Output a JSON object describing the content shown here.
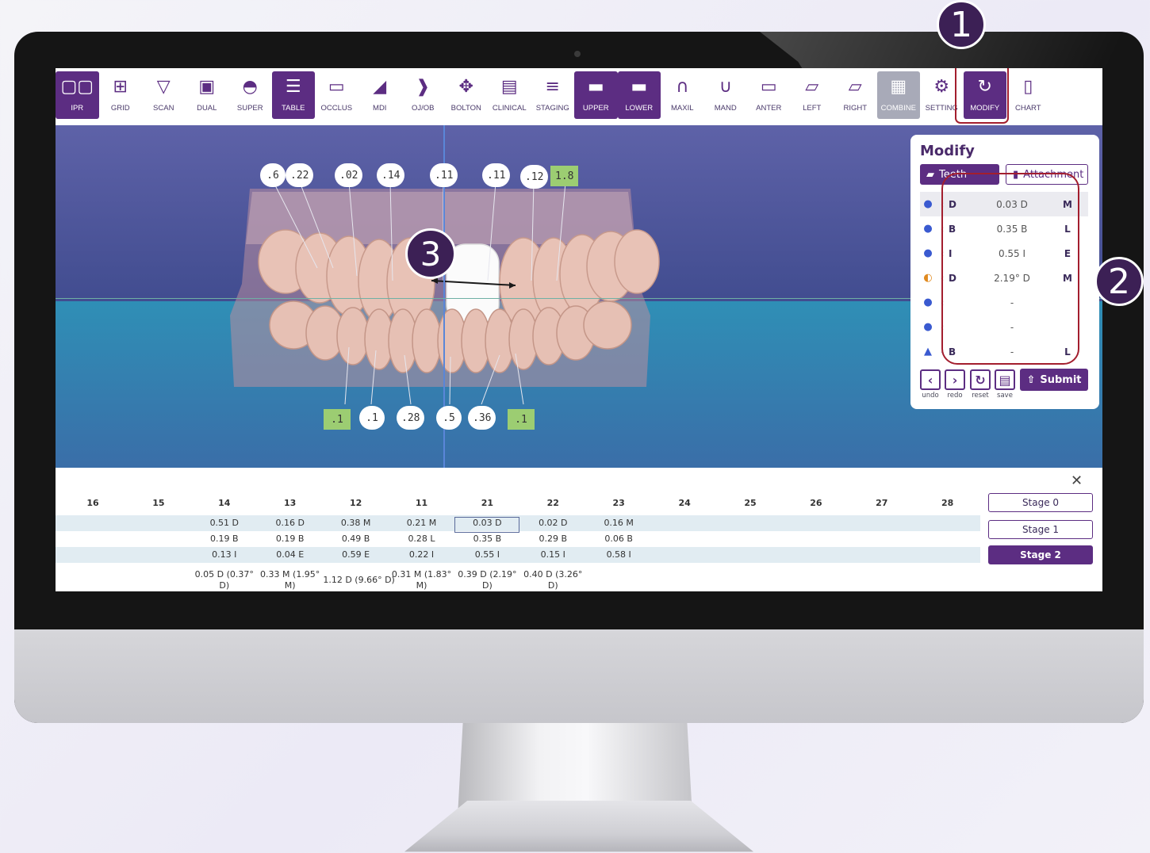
{
  "toolbar": {
    "items": [
      {
        "label": "IPR",
        "icon": "ipr-icon",
        "state": "active"
      },
      {
        "label": "GRID",
        "icon": "grid-icon",
        "state": "normal"
      },
      {
        "label": "SCAN",
        "icon": "scan-icon",
        "state": "normal"
      },
      {
        "label": "DUAL",
        "icon": "dual-icon",
        "state": "normal"
      },
      {
        "label": "SUPER",
        "icon": "super-icon",
        "state": "normal"
      },
      {
        "label": "TABLE",
        "icon": "table-icon",
        "state": "active"
      },
      {
        "label": "OCCLUS",
        "icon": "occlus-icon",
        "state": "normal"
      },
      {
        "label": "MDI",
        "icon": "mdi-icon",
        "state": "normal"
      },
      {
        "label": "OJ/OB",
        "icon": "ojob-icon",
        "state": "normal"
      },
      {
        "label": "BOLTON",
        "icon": "bolton-icon",
        "state": "normal"
      },
      {
        "label": "CLINICAL",
        "icon": "clinical-icon",
        "state": "normal"
      },
      {
        "label": "STAGING",
        "icon": "staging-icon",
        "state": "normal"
      },
      {
        "label": "UPPER",
        "icon": "upper-icon",
        "state": "active"
      },
      {
        "label": "LOWER",
        "icon": "lower-icon",
        "state": "active"
      },
      {
        "label": "MAXIL",
        "icon": "maxil-icon",
        "state": "normal"
      },
      {
        "label": "MAND",
        "icon": "mand-icon",
        "state": "normal"
      },
      {
        "label": "ANTER",
        "icon": "anter-icon",
        "state": "normal"
      },
      {
        "label": "LEFT",
        "icon": "left-icon",
        "state": "normal"
      },
      {
        "label": "RIGHT",
        "icon": "right-icon",
        "state": "normal"
      },
      {
        "label": "COMBINE",
        "icon": "combine-icon",
        "state": "greyed"
      },
      {
        "label": "SETTING",
        "icon": "gear-icon",
        "state": "normal"
      },
      {
        "label": "MODIFY",
        "icon": "refresh-icon",
        "state": "active"
      },
      {
        "label": "CHART",
        "icon": "chart-tooth-icon",
        "state": "normal"
      }
    ]
  },
  "viewport": {
    "upper_bubbles": [
      ".6",
      ".22",
      ".02",
      ".14",
      ".11",
      ".11",
      ".12"
    ],
    "upper_tag": "1.8",
    "lower_tag_left": ".1",
    "lower_bubbles": [
      ".1",
      ".28",
      ".5",
      ".36"
    ],
    "lower_tag_right": ".1",
    "marker": "3"
  },
  "modify_panel": {
    "title": "Modify",
    "tab_teeth": "Teeth",
    "tab_attachment": "Attachment",
    "rows": [
      {
        "icon": "tooth-move-icon",
        "dir": "D",
        "value": "0.03 D",
        "dir2": "M"
      },
      {
        "icon": "tooth-move-icon",
        "dir": "B",
        "value": "0.35 B",
        "dir2": "L"
      },
      {
        "icon": "tooth-move-icon",
        "dir": "I",
        "value": "0.55 I",
        "dir2": "E"
      },
      {
        "icon": "tooth-rotate-icon",
        "dir": "D",
        "value": "2.19° D",
        "dir2": "M"
      },
      {
        "icon": "tooth-tip-icon",
        "dir": "",
        "value": "-",
        "dir2": ""
      },
      {
        "icon": "tooth-torque-icon",
        "dir": "",
        "value": "-",
        "dir2": ""
      },
      {
        "icon": "tooth-root-icon",
        "dir": "B",
        "value": "-",
        "dir2": "L"
      }
    ],
    "controls": {
      "undo": "undo",
      "redo": "redo",
      "reset": "reset",
      "save": "save",
      "submit": "Submit"
    }
  },
  "table": {
    "headers": [
      "16",
      "15",
      "14",
      "13",
      "12",
      "11",
      "21",
      "22",
      "23",
      "24",
      "25",
      "26",
      "27",
      "28"
    ],
    "row1": [
      "",
      "",
      "0.51 D",
      "0.16 D",
      "0.38 M",
      "0.21 M",
      "0.03 D",
      "0.02 D",
      "0.16 M",
      "",
      "",
      "",
      "",
      ""
    ],
    "row2": [
      "",
      "",
      "0.19 B",
      "0.19 B",
      "0.49 B",
      "0.28 L",
      "0.35 B",
      "0.29 B",
      "0.06 B",
      "",
      "",
      "",
      "",
      ""
    ],
    "row3": [
      "",
      "",
      "0.13 I",
      "0.04 E",
      "0.59 E",
      "0.22 I",
      "0.55 I",
      "0.15 I",
      "0.58 I",
      "",
      "",
      "",
      "",
      ""
    ],
    "row4": [
      "",
      "",
      "0.05 D (0.37° D)",
      "0.33 M (1.95° M)",
      "1.12 D (9.66° D)",
      "0.31 M (1.83° M)",
      "0.39 D (2.19° D)",
      "0.40 D (3.26° D)",
      "",
      "",
      "",
      "",
      "",
      ""
    ],
    "stages": [
      "Stage 0",
      "Stage 1",
      "Stage 2"
    ],
    "active_stage": "Stage 2"
  },
  "callouts": [
    "1",
    "2"
  ],
  "colors": {
    "brand_purple": "#5c2d82",
    "highlight_red": "#a31e2e",
    "ipr_green": "#9ccd72"
  }
}
